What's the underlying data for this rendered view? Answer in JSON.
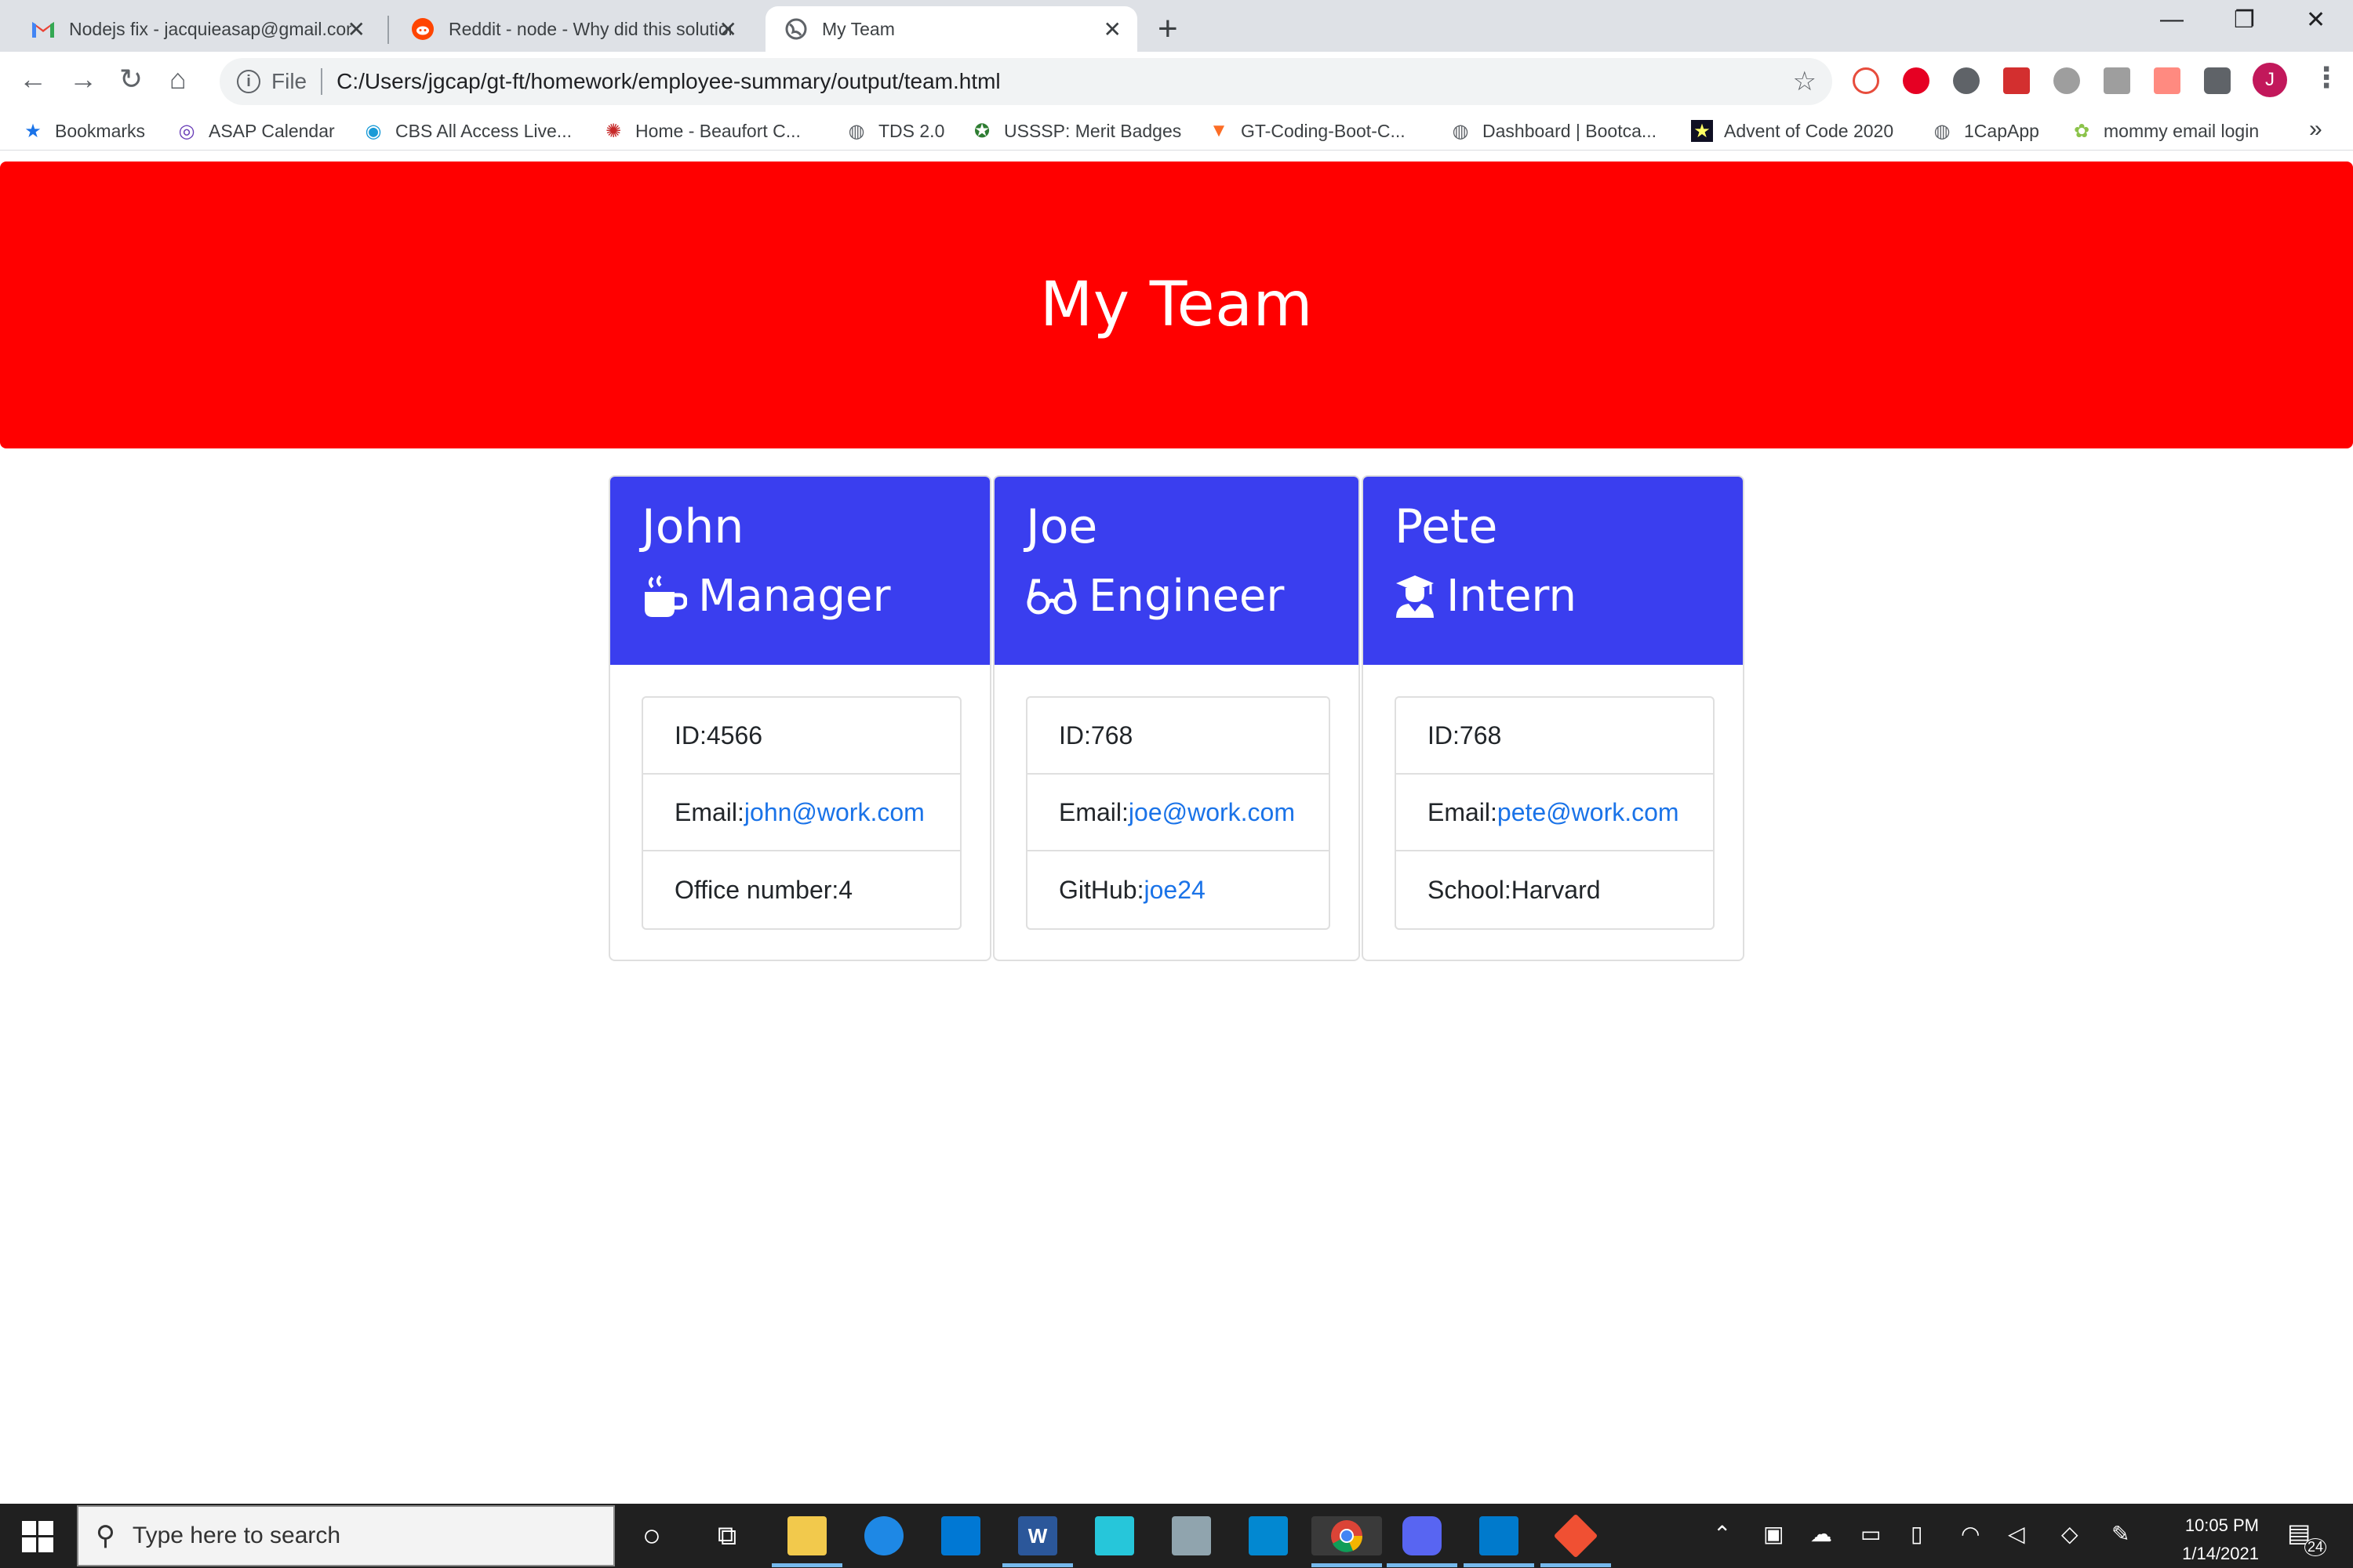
{
  "browser": {
    "tabs": [
      {
        "title": "Nodejs fix - jacquieasap@gmail.com",
        "favicon": "gmail-icon"
      },
      {
        "title": "Reddit - node - Why did this solution",
        "favicon": "reddit-icon"
      },
      {
        "title": "My Team",
        "favicon": "globe-icon"
      }
    ],
    "address": {
      "scheme_label": "File",
      "url": "C:/Users/jgcap/gt-ft/homework/employee-summary/output/team.html"
    },
    "profile_initial": "J",
    "bookmarks": [
      {
        "label": "Bookmarks",
        "icon": "star-icon"
      },
      {
        "label": "ASAP Calendar",
        "icon": "asap-icon"
      },
      {
        "label": "CBS All Access Live...",
        "icon": "cbs-icon"
      },
      {
        "label": "Home - Beaufort C...",
        "icon": "beaufort-icon"
      },
      {
        "label": "TDS 2.0",
        "icon": "globe-icon"
      },
      {
        "label": "USSSP: Merit Badges",
        "icon": "usssp-icon"
      },
      {
        "label": "GT-Coding-Boot-C...",
        "icon": "gitlab-icon"
      },
      {
        "label": "Dashboard | Bootca...",
        "icon": "globe-icon"
      },
      {
        "label": "Advent of Code 2020",
        "icon": "advent-icon"
      },
      {
        "label": "1CapApp",
        "icon": "globe-icon"
      },
      {
        "label": "mommy email login",
        "icon": "mommy-icon"
      }
    ],
    "bookmarks_more": "»"
  },
  "page": {
    "title": "My Team",
    "accent_header": "#ff0000",
    "card_header_color": "#3a3eef",
    "team": [
      {
        "name": "John",
        "role": "Manager",
        "role_icon": "mug-icon",
        "id_label": "ID: ",
        "id": "4566",
        "email_label": "Email: ",
        "email": "john@work.com",
        "extra_label": "Office number: ",
        "extra_value": "4"
      },
      {
        "name": "Joe",
        "role": "Engineer",
        "role_icon": "glasses-icon",
        "id_label": "ID: ",
        "id": "768",
        "email_label": "Email: ",
        "email": "joe@work.com",
        "extra_label": "GitHub: ",
        "extra_value": "joe24"
      },
      {
        "name": "Pete",
        "role": "Intern",
        "role_icon": "graduate-icon",
        "id_label": "ID: ",
        "id": "768",
        "email_label": "Email: ",
        "email": "pete@work.com",
        "extra_label": "School: ",
        "extra_value": "Harvard"
      }
    ]
  },
  "taskbar": {
    "search_placeholder": "Type here to search",
    "time": "10:05 PM",
    "date": "1/14/2021",
    "notification_count": "24"
  }
}
